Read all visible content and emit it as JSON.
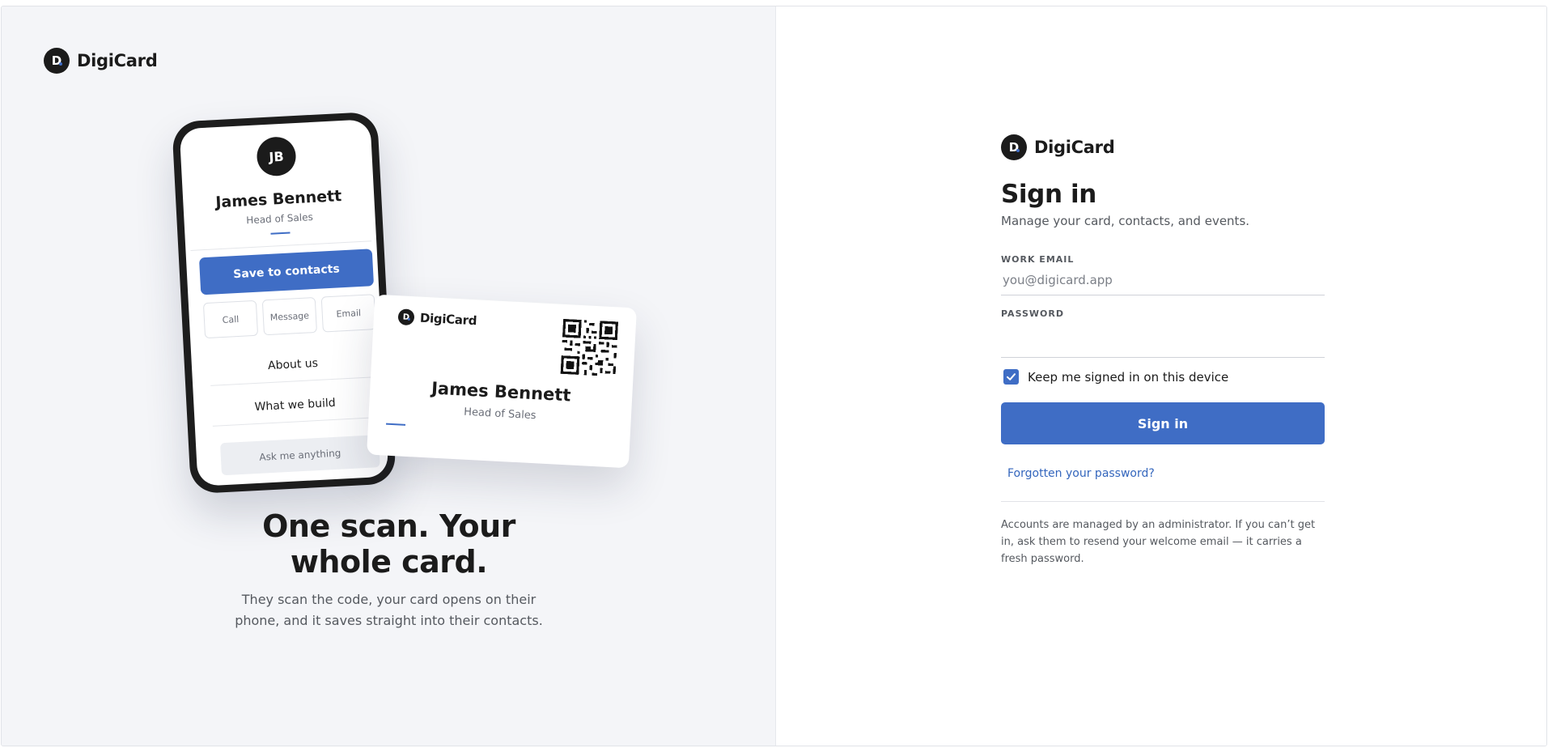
{
  "brand": {
    "name": "DigiCard",
    "mark": "D"
  },
  "phone": {
    "initials": "JB",
    "name": "James Bennett",
    "role": "Head of Sales",
    "save_label": "Save to contacts",
    "actions": [
      "Call",
      "Message",
      "Email"
    ],
    "rows": [
      "About us",
      "What we build"
    ],
    "ask_label": "Ask me anything"
  },
  "card": {
    "brand": "DigiCard",
    "name": "James Bennett",
    "role": "Head of Sales"
  },
  "hero": {
    "headline_line1": "One scan. Your",
    "headline_line2": "whole card.",
    "sub_line1": "They scan the code, your card opens on their",
    "sub_line2": "phone, and it saves straight into their contacts."
  },
  "form": {
    "title": "Sign in",
    "intro": "Manage your card, contacts, and events.",
    "email_label": "WORK EMAIL",
    "email_placeholder": "you@digicard.app",
    "email_value": "",
    "password_label": "PASSWORD",
    "password_value": "",
    "keep_label": "Keep me signed in on this device",
    "keep_checked": true,
    "submit_label": "Sign in",
    "forgot_label": "Forgotten your password?",
    "note": "Accounts are managed by an administrator. If you can’t get in, ask them to resend your welcome email — it carries a fresh password."
  },
  "colors": {
    "accent": "#3f6dc5",
    "dark": "#1b1b1b",
    "panel": "#f4f5f8"
  }
}
